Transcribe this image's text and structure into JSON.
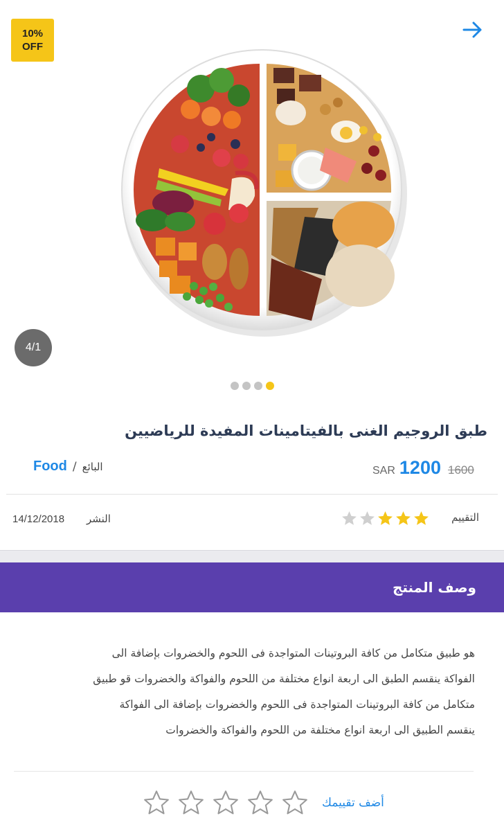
{
  "badge": {
    "line1": "10%",
    "line2": "OFF"
  },
  "gallery": {
    "counter": "4/1",
    "dots_total": 4,
    "active_dot": 4
  },
  "product": {
    "title": "طبق الروجيم الغنى بالفيتامينات المفيدة للرياضيين",
    "currency": "SAR",
    "price": "1200",
    "old_price": "1600",
    "seller_label": "البائع",
    "seller_sep": "/",
    "seller_name": "Food",
    "rating_label": "التقييم",
    "rating": 3,
    "rating_max": 5,
    "date_label": "النشر",
    "date": "14/12/2018"
  },
  "description": {
    "header": "وصف المنتج",
    "lines": [
      "هو طبيق متكامل من كافة البروتينات المتواجدة فى اللحوم والخضروات بإضافة الى",
      "الفواكة ينقسم الطبق الى اربعة انواع مختلفة من اللحوم والفواكة والخضروات قو طبيق",
      "متكامل من كافة البروتينات المتواجدة فى اللحوم والخضروات بإضافة الى الفواكة",
      "ينقسم الطبيق الى اربعة انواع مختلفة من اللحوم والفواكة والخضروات"
    ]
  },
  "review": {
    "add_label": "أضف تقييمك",
    "stars": 5
  },
  "colors": {
    "accent": "#1e88e5",
    "badge": "#f5c518",
    "header_bg": "#5a3fad",
    "star_filled": "#f5c518",
    "star_empty": "#cfcfcf"
  }
}
